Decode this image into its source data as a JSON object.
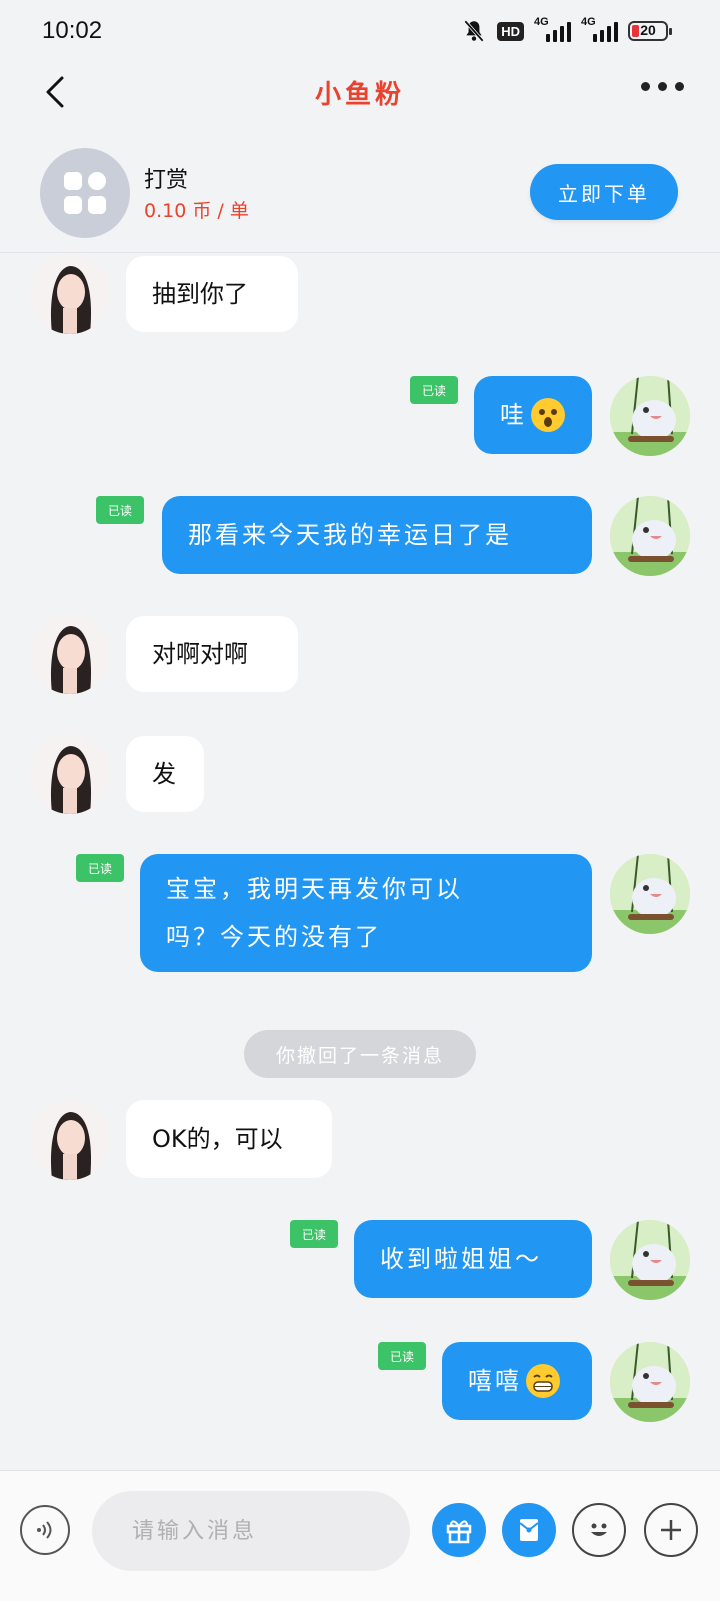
{
  "status": {
    "time": "10:02",
    "hd": "HD",
    "net1": "4G",
    "net2": "4G",
    "battery": "20"
  },
  "nav": {
    "title": "小鱼粉",
    "back_icon": "back-arrow-icon",
    "more_icon": "more-dots-icon"
  },
  "order": {
    "title": "打赏",
    "price": "0.10 币 / 单",
    "button": "立即下单"
  },
  "read_label": "已读",
  "messages": [
    {
      "text": "抽到你了"
    },
    {
      "text": "哇"
    },
    {
      "text": "那看来今天我的幸运日了是"
    },
    {
      "text": "对啊对啊"
    },
    {
      "text": "发"
    },
    {
      "line1": "宝宝，我明天再发你可以",
      "line2": "吗？今天的没有了"
    },
    {
      "text": "你撤回了一条消息"
    },
    {
      "text": "OK的，可以"
    },
    {
      "text": "收到啦姐姐～"
    },
    {
      "text": "嘻嘻"
    }
  ],
  "input": {
    "placeholder": "请输入消息"
  },
  "colors": {
    "accent": "#2196f3",
    "title_red": "#e8432e",
    "read_green": "#3cc267"
  }
}
